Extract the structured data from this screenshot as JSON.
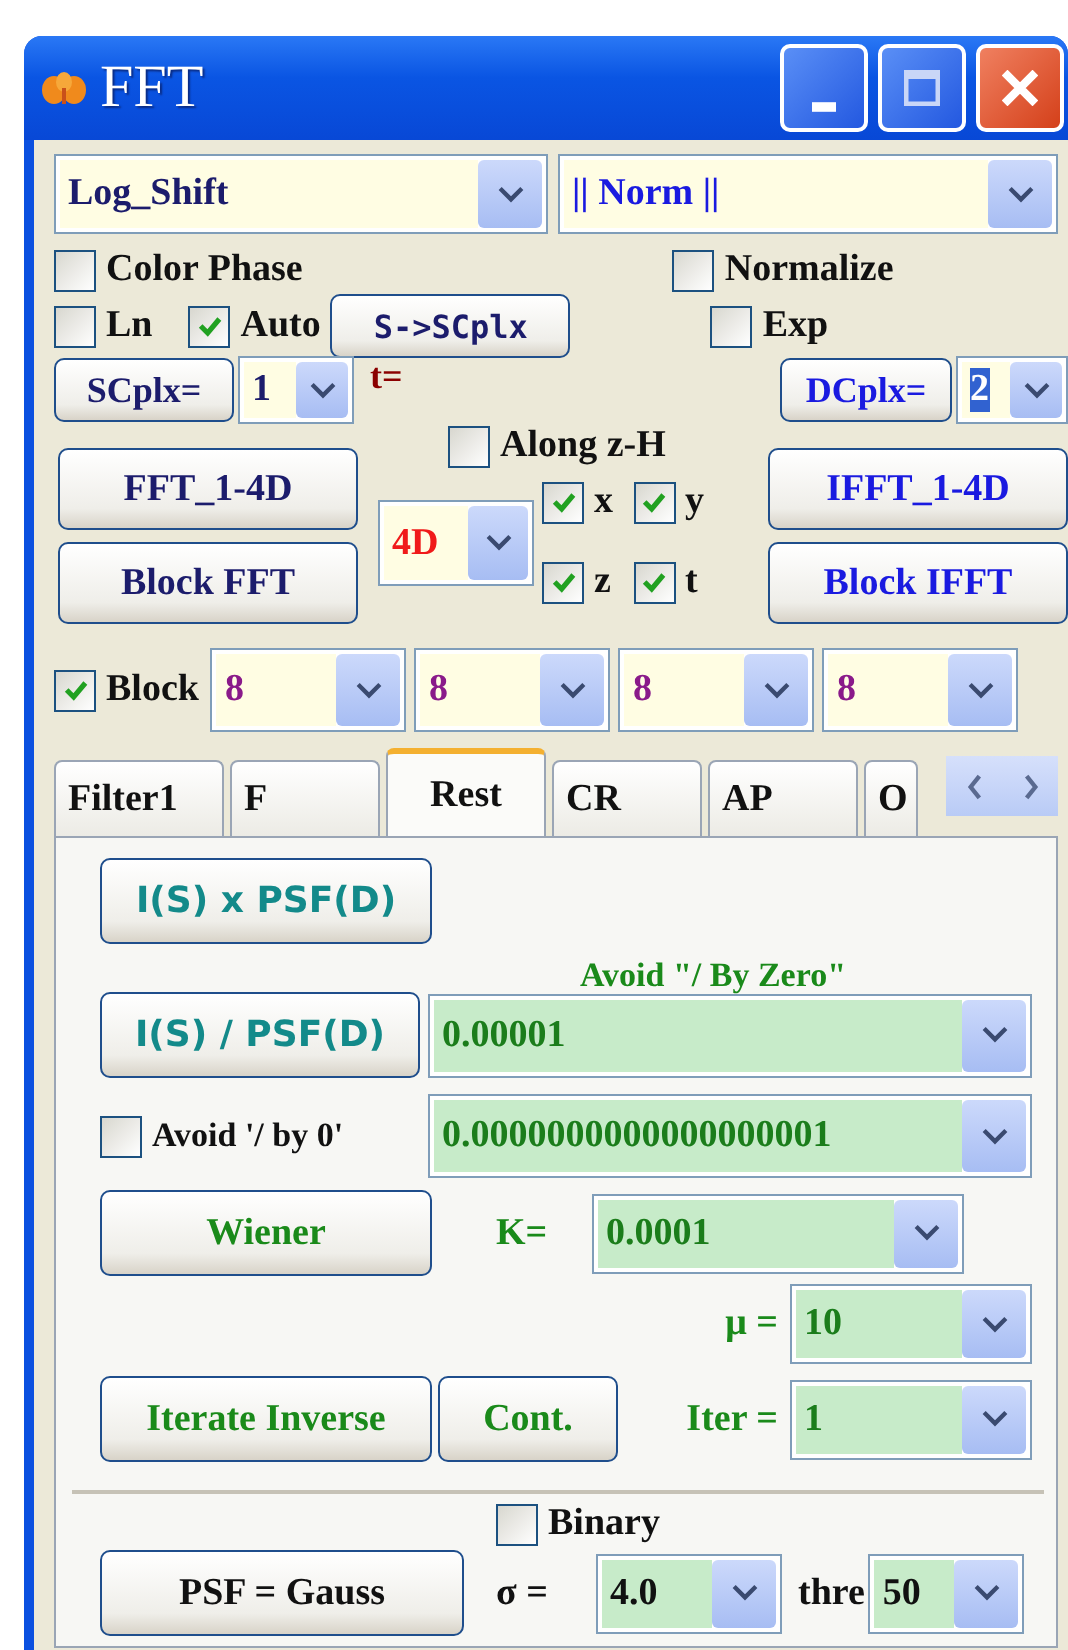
{
  "window": {
    "title": "FFT"
  },
  "mode_dropdown": {
    "value": "Log_Shift"
  },
  "norm_dropdown": {
    "value": "|| Norm ||"
  },
  "color_phase": {
    "label": "Color Phase",
    "checked": false
  },
  "normalize": {
    "label": "Normalize",
    "checked": false
  },
  "ln": {
    "label": "Ln",
    "checked": false
  },
  "auto": {
    "label": "Auto",
    "checked": true
  },
  "s_to_scplx_button": "S->SCplx",
  "exp": {
    "label": "Exp",
    "checked": false
  },
  "scplx": {
    "button": "SCplx=",
    "value": "1",
    "note": "t="
  },
  "dcplx": {
    "button": "DCplx=",
    "value": "2",
    "text_selected": true
  },
  "along_zh": {
    "label": "Along z-H",
    "checked": false
  },
  "axes": [
    {
      "label": "x",
      "checked": true
    },
    {
      "label": "y",
      "checked": true
    },
    {
      "label": "z",
      "checked": true
    },
    {
      "label": "t",
      "checked": true
    }
  ],
  "fft_button": "FFT_1-4D",
  "block_fft_button": "Block FFT",
  "dimension_dropdown": {
    "value": "4D"
  },
  "ifft_button": "IFFT_1-4D",
  "block_ifft_button": "Block IFFT",
  "block": {
    "label": "Block",
    "checked": true,
    "sizes": [
      "8",
      "8",
      "8",
      "8"
    ]
  },
  "tabs": [
    {
      "label": "Filter1",
      "selected": false
    },
    {
      "label": "F",
      "selected": false
    },
    {
      "label": "Rest",
      "selected": true
    },
    {
      "label": "CR",
      "selected": false
    },
    {
      "label": "AP",
      "selected": false
    },
    {
      "label": "O",
      "selected": false
    }
  ],
  "rest_panel": {
    "multiply_button": "I(S) x PSF(D)",
    "avoid_zero_caption": "Avoid \"/ By Zero\"",
    "divide_button": "I(S) / PSF(D)",
    "epsilon_dropdown": {
      "value": "0.00001"
    },
    "avoid_zero": {
      "label": "Avoid '/ by 0'",
      "checked": false
    },
    "tiny_dropdown": {
      "value": "0.0000000000000000001"
    },
    "wiener_button": "Wiener",
    "k_label": "K=",
    "k_dropdown": {
      "value": "0.0001"
    },
    "mu_label": "μ =",
    "mu_dropdown": {
      "value": "10"
    },
    "iterate_button": "Iterate Inverse",
    "cont_button": "Cont.",
    "iter_label": "Iter =",
    "iter_dropdown": {
      "value": "1"
    },
    "binary": {
      "label": "Binary",
      "checked": false
    },
    "psf_button": "PSF = Gauss",
    "sigma_label": "σ =",
    "sigma_dropdown": {
      "value": "4.0"
    },
    "thre_label": "thre",
    "thre_dropdown": {
      "value": "50"
    }
  }
}
